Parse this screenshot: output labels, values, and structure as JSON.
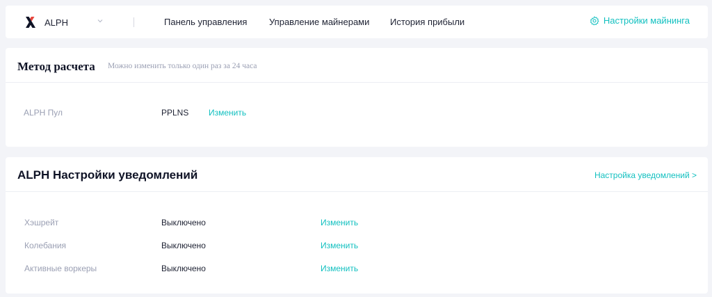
{
  "topbar": {
    "coin_name": "ALPH",
    "nav": {
      "dashboard": "Панель управления",
      "miners": "Управление майнерами",
      "history": "История прибыли"
    },
    "mining_settings": "Настройки майнинга"
  },
  "calc_method": {
    "title": "Метод расчета",
    "subtitle": "Можно изменить только один раз за 24 часа",
    "pool_label": "ALPH Пул",
    "pool_value": "PPLNS",
    "change_label": "Изменить"
  },
  "notifications": {
    "title": "ALPH Настройки уведомлений",
    "settings_link": "Настройка уведомлений >",
    "rows": [
      {
        "label": "Хэшрейт",
        "value": "Выключено",
        "action": "Изменить"
      },
      {
        "label": "Колебания",
        "value": "Выключено",
        "action": "Изменить"
      },
      {
        "label": "Активные воркеры",
        "value": "Выключено",
        "action": "Изменить"
      }
    ]
  },
  "colors": {
    "accent": "#12c0c0",
    "background": "#f3f4f8",
    "muted_text": "#9a9fb3",
    "primary_text": "#1e2233"
  }
}
